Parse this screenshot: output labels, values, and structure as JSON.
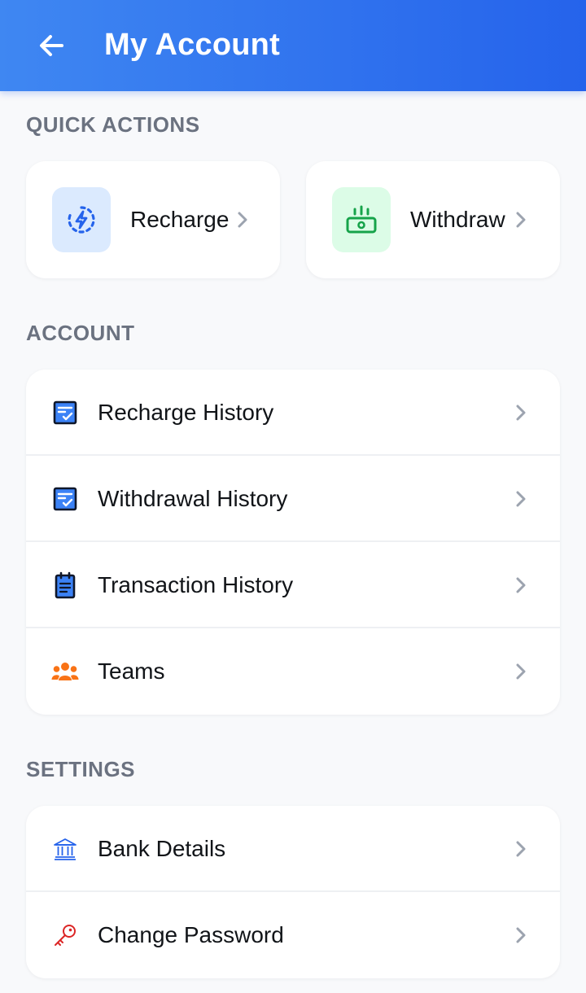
{
  "header": {
    "title": "My Account",
    "back_icon": "arrow-left-icon",
    "color_start": "#3f87f2",
    "color_end": "#2563eb"
  },
  "quick_actions": {
    "label": "QUICK ACTIONS",
    "items": [
      {
        "label": "Recharge",
        "icon": "recharge-bolt-icon",
        "icon_bg": "#dbeafe",
        "icon_color": "#2563eb"
      },
      {
        "label": "Withdraw",
        "icon": "cash-withdraw-icon",
        "icon_bg": "#dcfce7",
        "icon_color": "#16a34a"
      }
    ]
  },
  "account": {
    "label": "ACCOUNT",
    "items": [
      {
        "label": "Recharge History",
        "icon": "checklist-icon",
        "icon_color": "#2563eb"
      },
      {
        "label": "Withdrawal History",
        "icon": "checklist-icon",
        "icon_color": "#2563eb"
      },
      {
        "label": "Transaction History",
        "icon": "clipboard-icon",
        "icon_color": "#2563eb"
      },
      {
        "label": "Teams",
        "icon": "team-icon",
        "icon_color": "#f97316"
      }
    ]
  },
  "settings": {
    "label": "SETTINGS",
    "items": [
      {
        "label": "Bank Details",
        "icon": "bank-icon",
        "icon_color": "#2563eb"
      },
      {
        "label": "Change Password",
        "icon": "key-icon",
        "icon_color": "#dc2626"
      }
    ]
  }
}
